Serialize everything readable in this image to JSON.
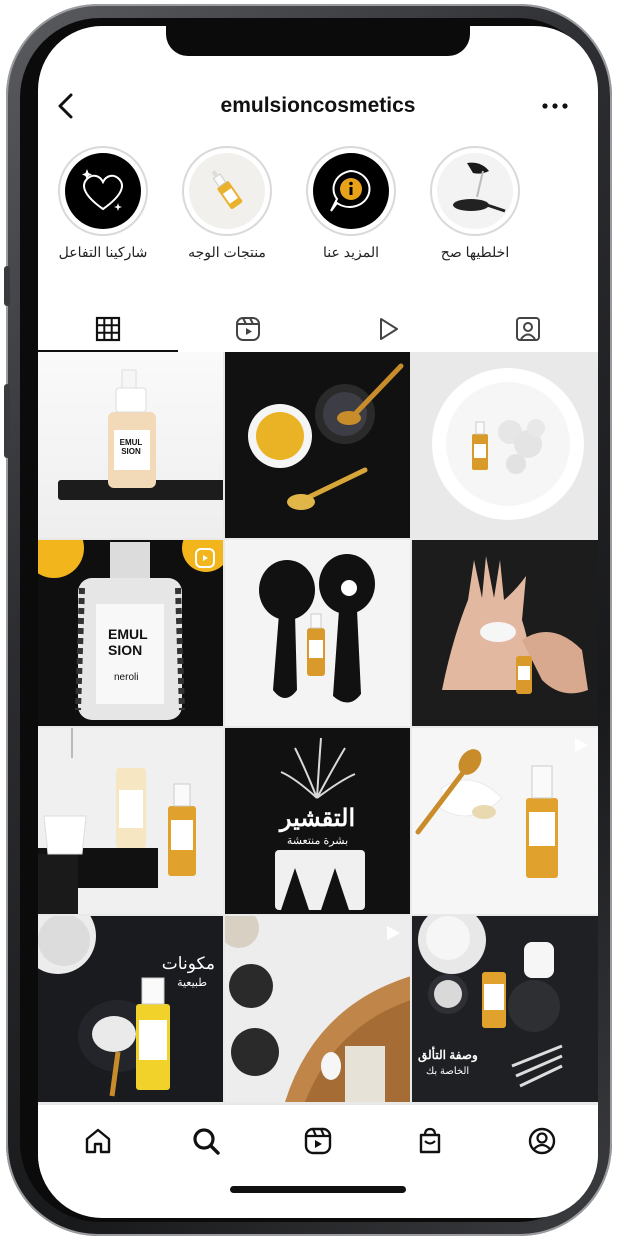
{
  "header": {
    "username": "emulsioncosmetics"
  },
  "highlights": [
    {
      "label": "شاركينا التفاعل",
      "icon": "heart-sparkle-icon"
    },
    {
      "label": "منتجات الوجه",
      "icon": "serum-bottle-icon"
    },
    {
      "label": "المزيد عنا",
      "icon": "info-chat-icon"
    },
    {
      "label": "اخلطيها صح",
      "icon": "pouring-spoon-icon"
    }
  ],
  "tabs": [
    {
      "name": "grid",
      "icon": "grid-icon",
      "active": true
    },
    {
      "name": "reels",
      "icon": "reels-icon",
      "active": false
    },
    {
      "name": "videos",
      "icon": "play-icon",
      "active": false
    },
    {
      "name": "tagged",
      "icon": "tagged-person-icon",
      "active": false
    }
  ],
  "posts": {
    "p1_brand": "EMUL SION",
    "p4_brand_line1": "EMUL",
    "p4_brand_line2": "SION",
    "p4_product": "neroli",
    "p8_title": "التقشير",
    "p8_subtitle": "بشرة منتعشة",
    "p10_title": "مكونات",
    "p10_subtitle": "طبيعية",
    "p12_title": "وصفة التألق",
    "p12_subtitle": "الخاصة بك"
  },
  "bottom_nav": [
    {
      "name": "home",
      "icon": "home-icon"
    },
    {
      "name": "search",
      "icon": "search-icon"
    },
    {
      "name": "reels",
      "icon": "reels-icon"
    },
    {
      "name": "shop",
      "icon": "shopping-bag-icon"
    },
    {
      "name": "profile",
      "icon": "profile-icon"
    }
  ],
  "colors": {
    "accent_gold": "#e8a21a",
    "dark": "#111111",
    "frame": "#2c2d30"
  }
}
